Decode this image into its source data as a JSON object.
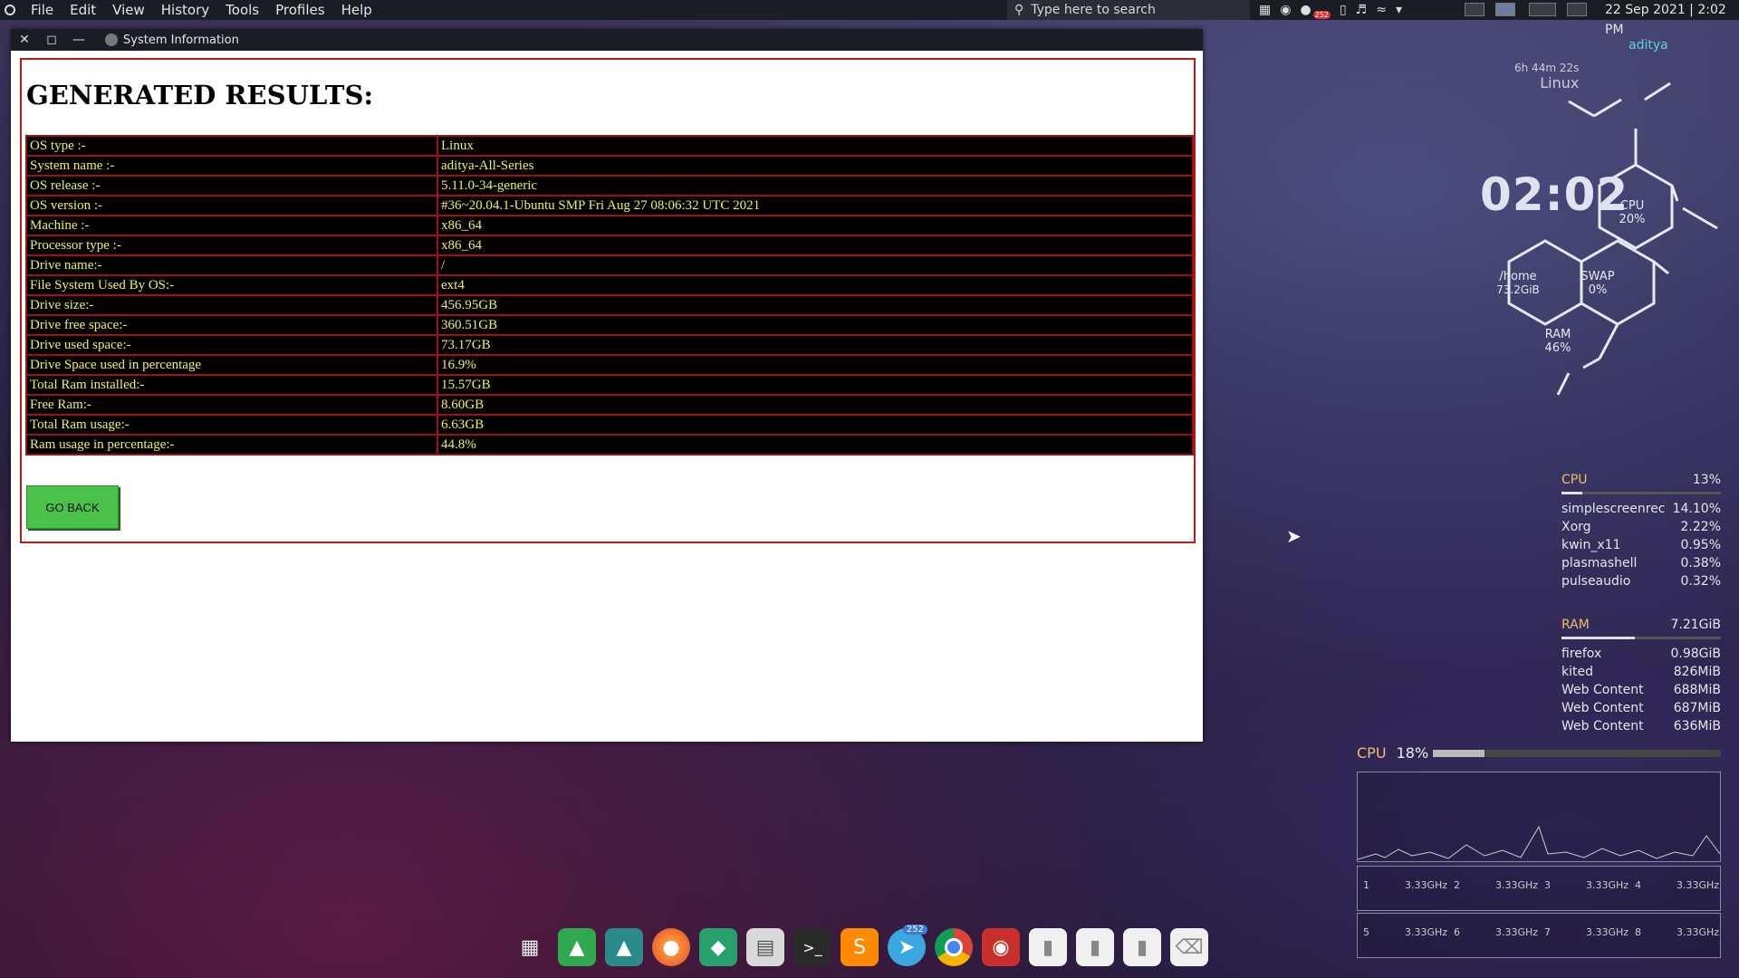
{
  "menubar": {
    "items": [
      "File",
      "Edit",
      "View",
      "History",
      "Tools",
      "Profiles",
      "Help"
    ],
    "search_placeholder": "Type here to search",
    "datetime": "22 Sep 2021 | 2:02 PM",
    "badge": "252"
  },
  "window": {
    "title": "System Information"
  },
  "page": {
    "heading": "GENERATED RESULTS:",
    "rows": [
      {
        "key": "OS type :-",
        "value": "Linux"
      },
      {
        "key": "System name :-",
        "value": "aditya-All-Series"
      },
      {
        "key": "OS release :-",
        "value": "5.11.0-34-generic"
      },
      {
        "key": "OS version :-",
        "value": "#36~20.04.1-Ubuntu SMP Fri Aug 27 08:06:32 UTC 2021"
      },
      {
        "key": "Machine :-",
        "value": "x86_64"
      },
      {
        "key": "Processor type :-",
        "value": "x86_64"
      },
      {
        "key": "Drive name:-",
        "value": "/"
      },
      {
        "key": "File System Used By OS:-",
        "value": "ext4"
      },
      {
        "key": "Drive size:-",
        "value": "456.95GB"
      },
      {
        "key": "Drive free space:-",
        "value": "360.51GB"
      },
      {
        "key": "Drive used space:-",
        "value": "73.17GB"
      },
      {
        "key": "Drive Space used in percentage",
        "value": "16.9%"
      },
      {
        "key": "Total Ram installed:-",
        "value": "15.57GB"
      },
      {
        "key": "Free Ram:-",
        "value": "8.60GB"
      },
      {
        "key": "Total Ram usage:-",
        "value": "6.63GB"
      },
      {
        "key": "Ram usage in percentage:-",
        "value": "44.8%"
      }
    ],
    "go_back_label": "GO BACK"
  },
  "desktop": {
    "clock": "02:02",
    "uptime": "6h 44m 22s",
    "os": "Linux",
    "user": "aditya",
    "hex": {
      "cpu": "CPU",
      "cpu_val": "20%",
      "home": "/home",
      "home_val": "73.2GiB",
      "swap": "SWAP",
      "swap_val": "0%",
      "ram": "RAM",
      "ram_val": "46%"
    },
    "cpu_panel": {
      "label": "CPU",
      "total": "13%",
      "processes": [
        {
          "name": "simplescreenrec",
          "value": "14.10%"
        },
        {
          "name": "Xorg",
          "value": "2.22%"
        },
        {
          "name": "kwin_x11",
          "value": "0.95%"
        },
        {
          "name": "plasmashell",
          "value": "0.38%"
        },
        {
          "name": "pulseaudio",
          "value": "0.32%"
        }
      ]
    },
    "ram_panel": {
      "label": "RAM",
      "total": "7.21GiB",
      "processes": [
        {
          "name": "firefox",
          "value": "0.98GiB"
        },
        {
          "name": "kited",
          "value": "826MiB"
        },
        {
          "name": "Web Content",
          "value": "688MiB"
        },
        {
          "name": "Web Content",
          "value": "687MiB"
        },
        {
          "name": "Web Content",
          "value": "636MiB"
        }
      ]
    },
    "cpu_graph": {
      "label": "CPU",
      "value": "18%",
      "cores": [
        {
          "n": "1",
          "freq": "3.33GHz"
        },
        {
          "n": "2",
          "freq": "3.33GHz"
        },
        {
          "n": "3",
          "freq": "3.33GHz"
        },
        {
          "n": "4",
          "freq": "3.33GHz"
        },
        {
          "n": "5",
          "freq": "3.33GHz"
        },
        {
          "n": "6",
          "freq": "3.33GHz"
        },
        {
          "n": "7",
          "freq": "3.33GHz"
        },
        {
          "n": "8",
          "freq": "3.33GHz"
        }
      ]
    }
  },
  "dock": {
    "icons": [
      "apps-grid-icon",
      "system-monitor-icon",
      "software-center-icon",
      "firefox-icon",
      "kite-icon",
      "files-drawer-icon",
      "terminal-icon",
      "sublime-text-icon",
      "telegram-icon",
      "chrome-icon",
      "screen-recorder-icon",
      "folder-icon",
      "folder-icon",
      "folder-icon",
      "trash-icon"
    ],
    "telegram_badge": "252"
  }
}
